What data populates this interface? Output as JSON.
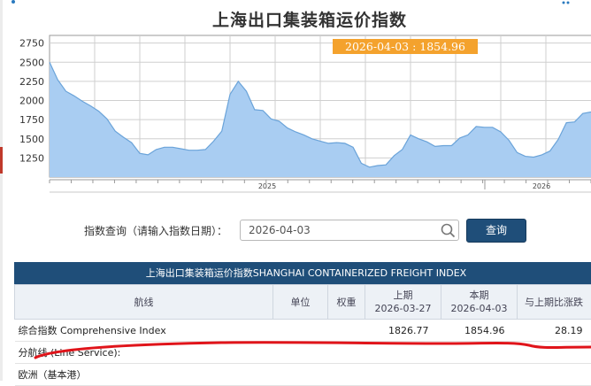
{
  "chart": {
    "title": "上海出口集装箱运价指数",
    "tooltip": "2026-04-03 : 1854.96"
  },
  "chart_data": {
    "type": "area",
    "title": "上海出口集装箱运价指数",
    "y_ticks": [
      "2750",
      "2500",
      "2250",
      "2000",
      "1750",
      "1500",
      "1250"
    ],
    "x_ticks": [
      "2025",
      "2026"
    ],
    "ylim": [
      1000,
      2850
    ],
    "grid": true,
    "values": [
      2500,
      2270,
      2120,
      2060,
      1990,
      1930,
      1860,
      1760,
      1600,
      1520,
      1450,
      1310,
      1290,
      1360,
      1390,
      1390,
      1370,
      1350,
      1350,
      1360,
      1470,
      1600,
      2080,
      2250,
      2120,
      1880,
      1870,
      1760,
      1730,
      1640,
      1590,
      1550,
      1500,
      1470,
      1440,
      1450,
      1440,
      1390,
      1180,
      1130,
      1150,
      1160,
      1280,
      1360,
      1550,
      1500,
      1460,
      1400,
      1410,
      1410,
      1510,
      1550,
      1660,
      1650,
      1650,
      1590,
      1480,
      1320,
      1270,
      1260,
      1290,
      1340,
      1490,
      1710,
      1720,
      1830,
      1850
    ],
    "highlight": {
      "date": "2026-04-03",
      "value": 1854.96
    }
  },
  "query": {
    "label": "指数查询（请输入指数日期）：",
    "date_value": "2026-04-03",
    "button": "查询"
  },
  "table": {
    "header": "上海出口集装箱运价指数SHANGHAI CONTAINERIZED FREIGHT INDEX",
    "columns": {
      "route": "航线",
      "unit": "单位",
      "weight": "权重",
      "prev_label": "上期",
      "prev_date": "2026-03-27",
      "curr_label": "本期",
      "curr_date": "2026-04-03",
      "change": "与上期比涨跌"
    },
    "rows": [
      {
        "route": "综合指数 Comprehensive Index",
        "unit": "",
        "weight": "",
        "prev": "1826.77",
        "curr": "1854.96",
        "change": "28.19"
      },
      {
        "route": "分航线 (Line Service):",
        "unit": "",
        "weight": "",
        "prev": "",
        "curr": "",
        "change": ""
      },
      {
        "route": "欧洲（基本港）",
        "unit": "",
        "weight": "",
        "prev": "",
        "curr": "",
        "change": ""
      }
    ]
  },
  "colors": {
    "area_fill": "#a9cdf2",
    "area_line": "#6aa3d9",
    "tooltip_bg": "#f4a22d",
    "header_bg": "#1f4e79",
    "annotation": "#e0141a"
  }
}
